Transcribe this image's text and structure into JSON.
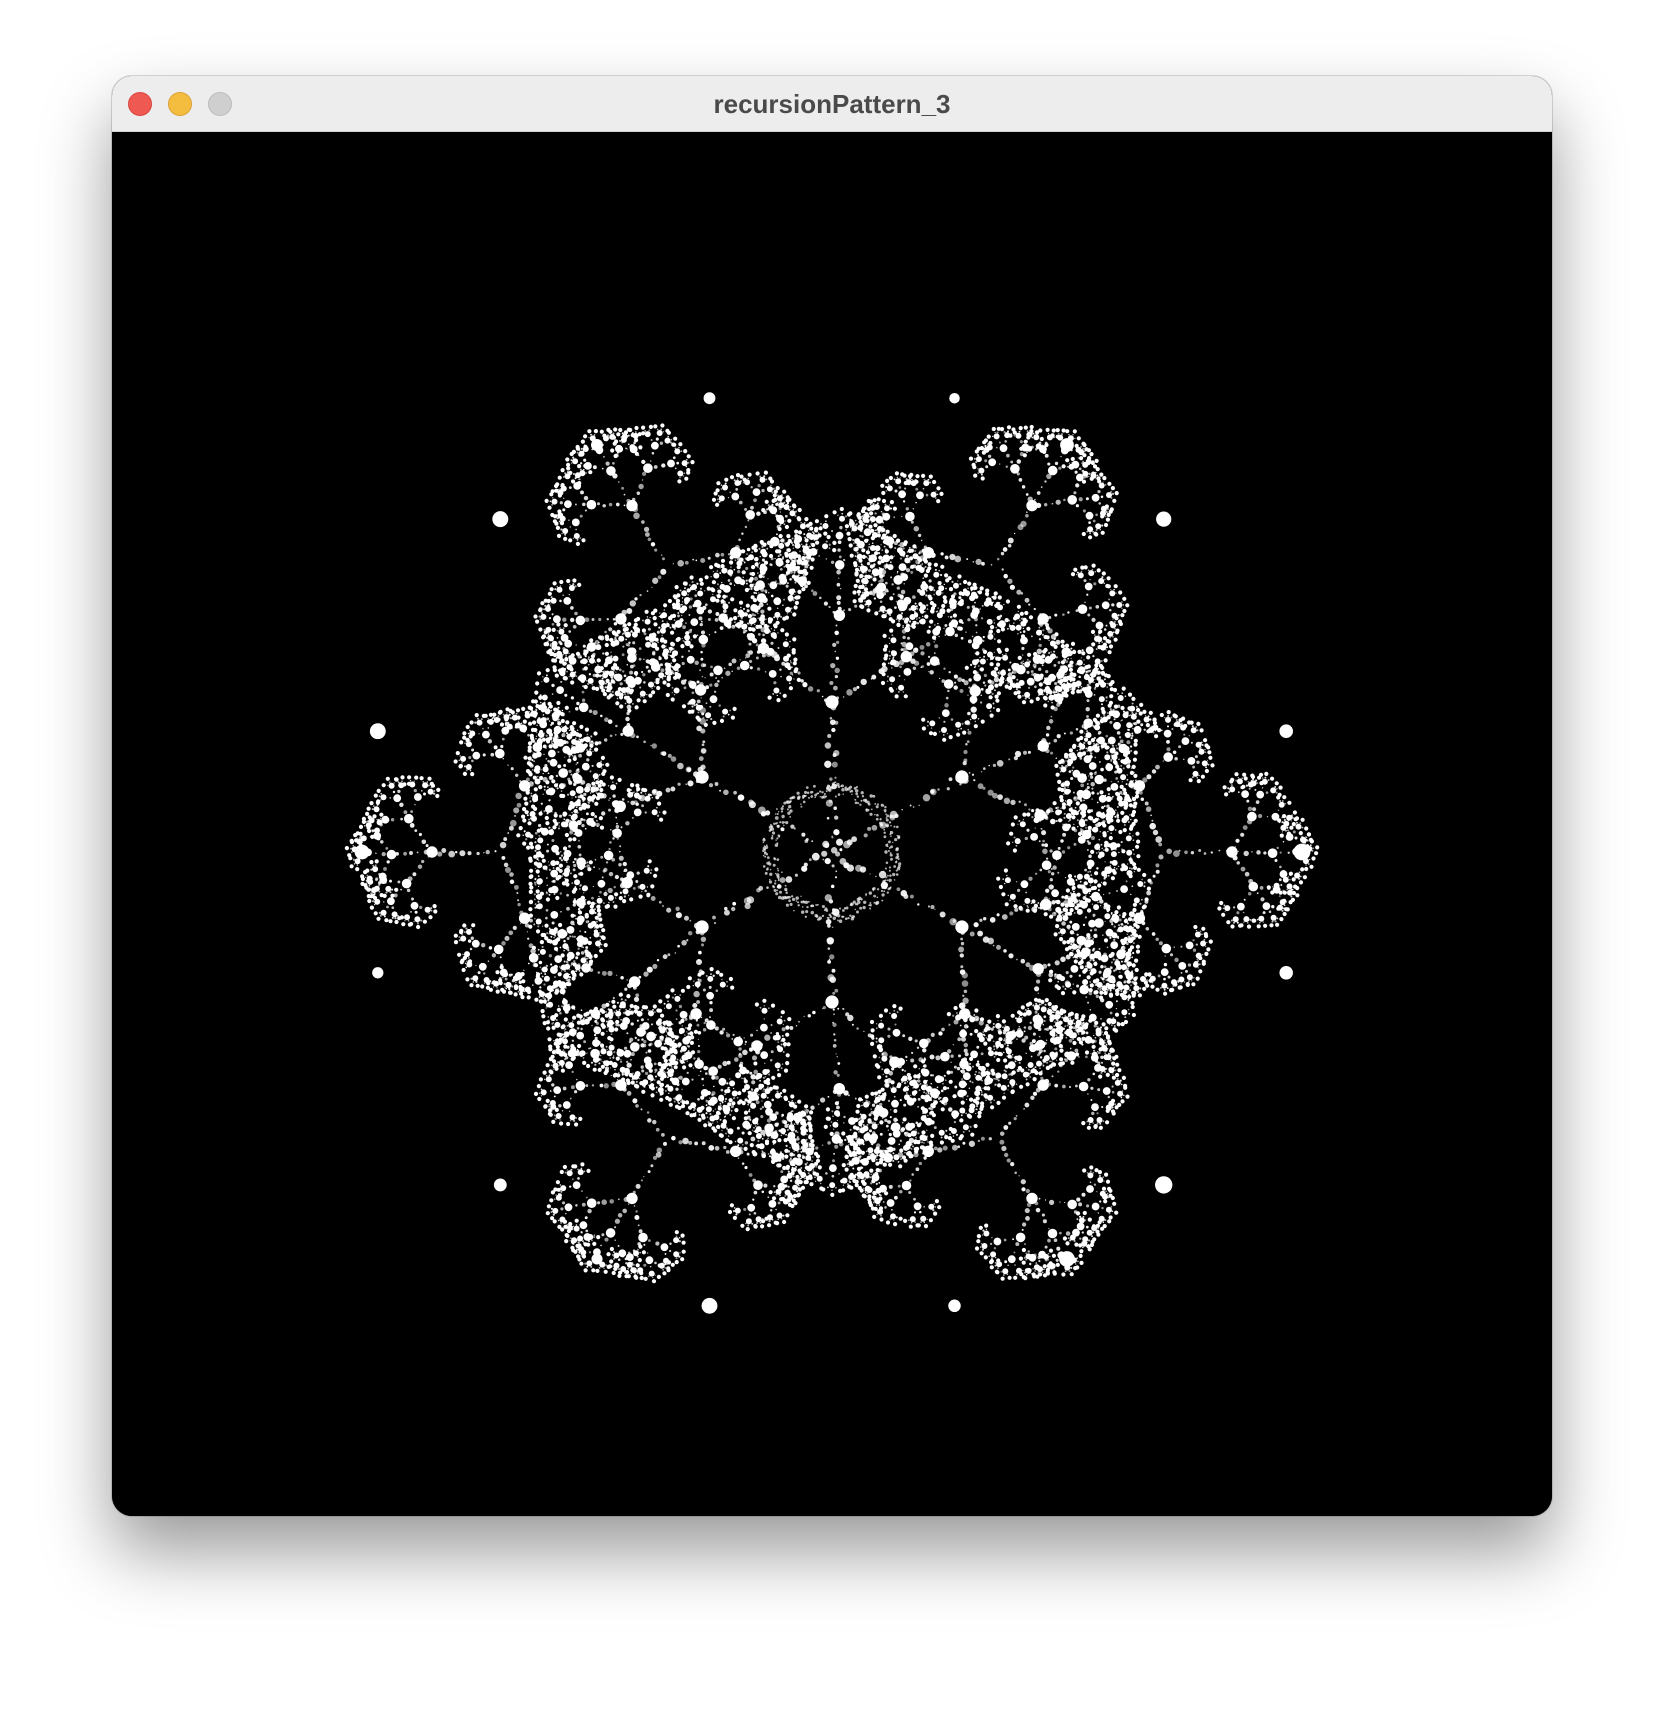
{
  "window": {
    "title": "recursionPattern_3"
  },
  "controls": {
    "close_icon": "close-icon",
    "minimize_icon": "minimize-icon",
    "zoom_icon": "zoom-icon",
    "colors": {
      "close": "#ee5a52",
      "minimize": "#f5bd3f",
      "zoom": "#cfcfcf"
    }
  },
  "canvas": {
    "background": "#000000",
    "dot_color": "#ffffff",
    "pattern": "recursive-dot-snowflake",
    "arms": 6
  }
}
